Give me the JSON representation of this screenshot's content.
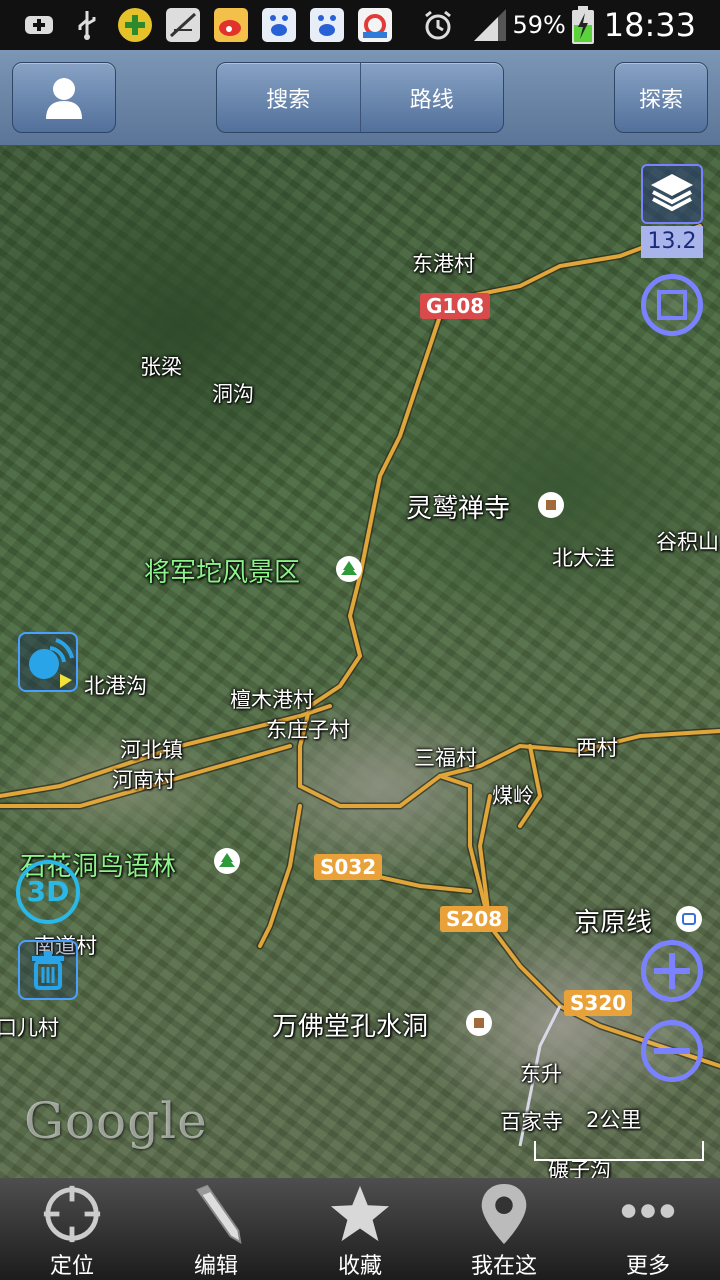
{
  "status_bar": {
    "battery": "59%",
    "time": "18:33",
    "icons": [
      "plus-icon",
      "usb-icon",
      "game-icon",
      "signal-off-icon",
      "weibo-icon",
      "baidu-icon",
      "baidu-icon",
      "store-icon",
      "alarm-icon",
      "signal-icon",
      "battery-charging-icon"
    ]
  },
  "toolbar": {
    "avatar_icon": "user-icon",
    "search_label": "搜索",
    "route_label": "路线",
    "explore_label": "探索"
  },
  "map": {
    "zoom_level": "13.2",
    "scale_label": "2公里",
    "attribution": "Google",
    "places": {
      "donggang": "东港村",
      "zhangliang": "张梁",
      "donggou": "洞沟",
      "lingjiu": "灵鹫禅寺",
      "beidawa": "北大洼",
      "guji": "谷积山",
      "jiangjun": "将军坨风景区",
      "beigang": "北港沟",
      "tanmu": "檀木港村",
      "dongzhuang": "东庄子村",
      "hebei": "河北镇",
      "henan": "河南村",
      "sanfu": "三福村",
      "xicun": "西村",
      "meiling": "煤岭",
      "shihua": "石花洞鸟语林",
      "jingyuan": "京原线",
      "nandao": "南道村",
      "kouer": "口儿村",
      "wanfo": "万佛堂孔水洞",
      "dongsheng": "东升",
      "baijiasi": "百家寺",
      "niyugou": "碾子沟"
    },
    "roads": {
      "g108": "G108",
      "s032": "S032",
      "s208": "S208",
      "s320": "S320"
    },
    "controls": {
      "layers_icon": "layers-icon",
      "fullscreen_icon": "square-icon",
      "compass_icon": "compass-icon",
      "three_d": "3D",
      "trash_icon": "trash-icon",
      "zoom_in_icon": "plus-circle-icon",
      "zoom_out_icon": "minus-circle-icon"
    }
  },
  "bottom_nav": {
    "locate": "定位",
    "edit": "编辑",
    "favorite": "收藏",
    "here": "我在这",
    "more": "更多"
  },
  "colors": {
    "toolbar": "#6a86a8",
    "control_accent": "#7a82ff",
    "road": "#e0a63a",
    "scenic_label": "#8ef28a"
  }
}
